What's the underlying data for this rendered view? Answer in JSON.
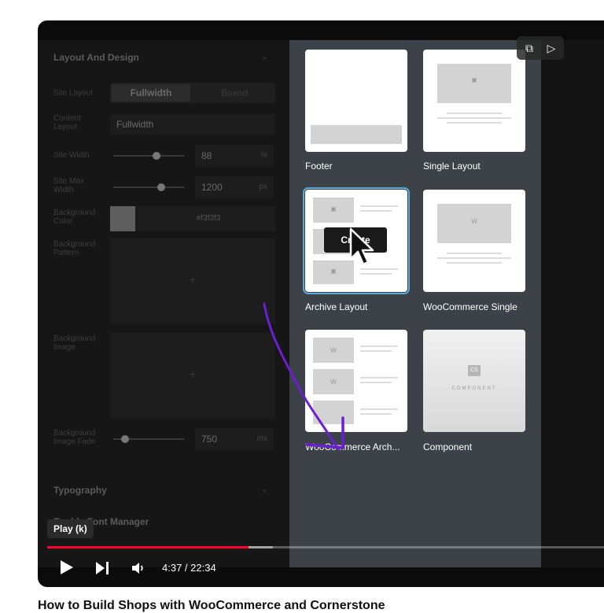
{
  "video_title": "How to Build Shops with WooCommerce and Cornerstone",
  "editor": {
    "section_layout": "Layout And Design",
    "row_labels": [
      "Site Layout",
      "Content Layout",
      "Site Width",
      "Site Max Width",
      "Background Color",
      "Background Pattern",
      "Background Image",
      "Background Image Fade"
    ],
    "layout_options": [
      "Fullwidth",
      "Boxed"
    ],
    "content_layout_value": "Fullwidth",
    "site_width_value": "88",
    "site_width_unit": "%",
    "site_max_width_value": "1200",
    "site_max_width_unit": "px",
    "bg_color_value": "#f3f3f3",
    "bg_image_fade_value": "750",
    "bg_image_fade_unit": "ms",
    "section_typography": "Typography",
    "font_manager_label": "Enable Font Manager",
    "add_glyph": "+"
  },
  "templates": [
    {
      "label": "Footer"
    },
    {
      "label": "Single Layout"
    },
    {
      "label": "Archive Layout"
    },
    {
      "label": "WooCommerce Single"
    },
    {
      "label": "WooCommerce Arch..."
    },
    {
      "label": "Component"
    }
  ],
  "create_button": "Create",
  "component_card_text": "COMPONENT",
  "player": {
    "tooltip": "Play (k)",
    "time": "4:37 / 22:34",
    "progress_played": 0.352,
    "progress_buffered": 0.394
  },
  "colors": {
    "progress_red": "#ff0033",
    "selected_outline": "#5aa9d6",
    "annotation_purple": "#6a1fd0"
  }
}
